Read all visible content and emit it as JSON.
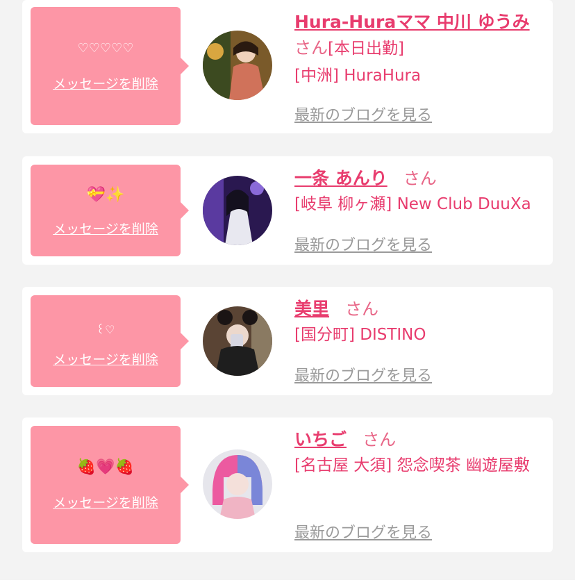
{
  "cards": [
    {
      "emoji": "♡♡♡♡♡",
      "delete_label": "メッセージを削除",
      "name": "Hura-Huraママ 中川 ゆうみ",
      "honorific": "さん",
      "status": "[本日出勤]",
      "shop": "[中洲] HuraHura",
      "blog_label": "最新のブログを見る"
    },
    {
      "emoji": "💝✨",
      "delete_label": "メッセージを削除",
      "name": "一条 あんり",
      "honorific": "さん",
      "shop": "[岐阜 柳ヶ瀬] New Club DuuXa",
      "blog_label": "最新のブログを見る"
    },
    {
      "emoji": "꒰♡",
      "delete_label": "メッセージを削除",
      "name": "美里",
      "honorific": "さん",
      "shop": "[国分町] DISTINO",
      "blog_label": "最新のブログを見る"
    },
    {
      "emoji": "🍓💗🍓",
      "delete_label": "メッセージを削除",
      "name": "いちご",
      "honorific": "さん",
      "shop": "[名古屋 大須] 怨念喫茶 幽遊屋敷",
      "blog_label": "最新のブログを見る"
    }
  ],
  "colors": {
    "accent": "#e83c6e",
    "message_box": "#fd96a6",
    "link_gray": "#9a9a9a",
    "background": "#f3f3f3"
  }
}
